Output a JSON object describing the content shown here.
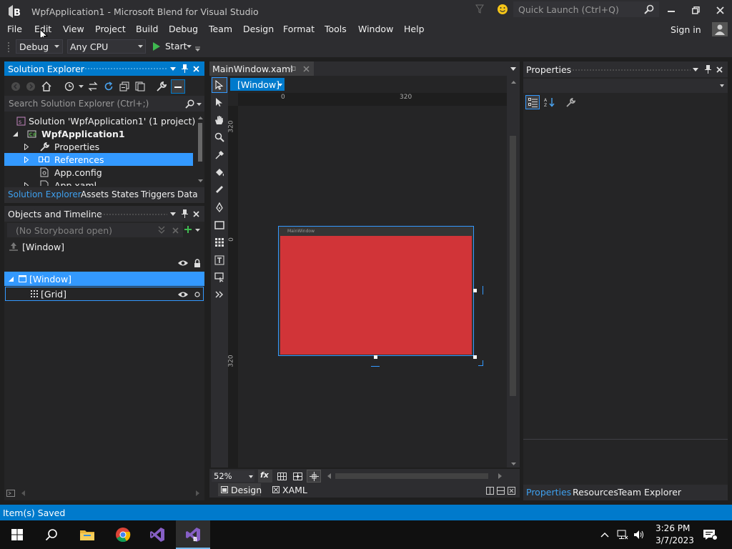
{
  "title_bar": {
    "window_title": "WpfApplication1 - Microsoft Blend for Visual Studio",
    "quick_launch_placeholder": "Quick Launch (Ctrl+Q)"
  },
  "menu": {
    "items": [
      "File",
      "Edit",
      "View",
      "Project",
      "Build",
      "Debug",
      "Team",
      "Design",
      "Format",
      "Tools",
      "Window",
      "Help"
    ],
    "sign_in": "Sign in"
  },
  "toolbar": {
    "configuration": "Debug",
    "platform": "Any CPU",
    "start_label": "Start"
  },
  "solution_explorer": {
    "title": "Solution Explorer",
    "search_placeholder": "Search Solution Explorer (Ctrl+;)",
    "tree": [
      "Solution 'WpfApplication1' (1 project)",
      "WpfApplication1",
      "Properties",
      "References",
      "App.config",
      "App.xaml"
    ],
    "selected": "References",
    "tabs": [
      "Solution Explorer",
      "Assets",
      "States",
      "Triggers",
      "Data"
    ]
  },
  "objects_timeline": {
    "title": "Objects and Timeline",
    "storyboard": "(No Storyboard open)",
    "scope": "[Window]",
    "tree": [
      "[Window]",
      "[Grid]"
    ]
  },
  "document": {
    "tab": "MainWindow.xaml",
    "breadcrumb": "[Window]",
    "ruler_top": [
      "0",
      "320"
    ],
    "ruler_left": [
      "320",
      "0",
      "320"
    ],
    "artboard_title": "MainWindow",
    "zoom": "52%",
    "fx": "fx",
    "view_tabs": [
      "Design",
      "XAML"
    ]
  },
  "properties": {
    "title": "Properties",
    "bottom_tabs": [
      "Properties",
      "Resources",
      "Team Explorer"
    ]
  },
  "status_bar": {
    "message": "Item(s) Saved"
  },
  "taskbar": {
    "time": "3:26 PM",
    "date": "3/7/2023"
  },
  "colors": {
    "accent": "#007acc",
    "selection": "#3399ff",
    "canvas": "#252526",
    "artboard_fill": "#d13438",
    "status_bar": "#007acc",
    "taskbar": "#101010"
  }
}
